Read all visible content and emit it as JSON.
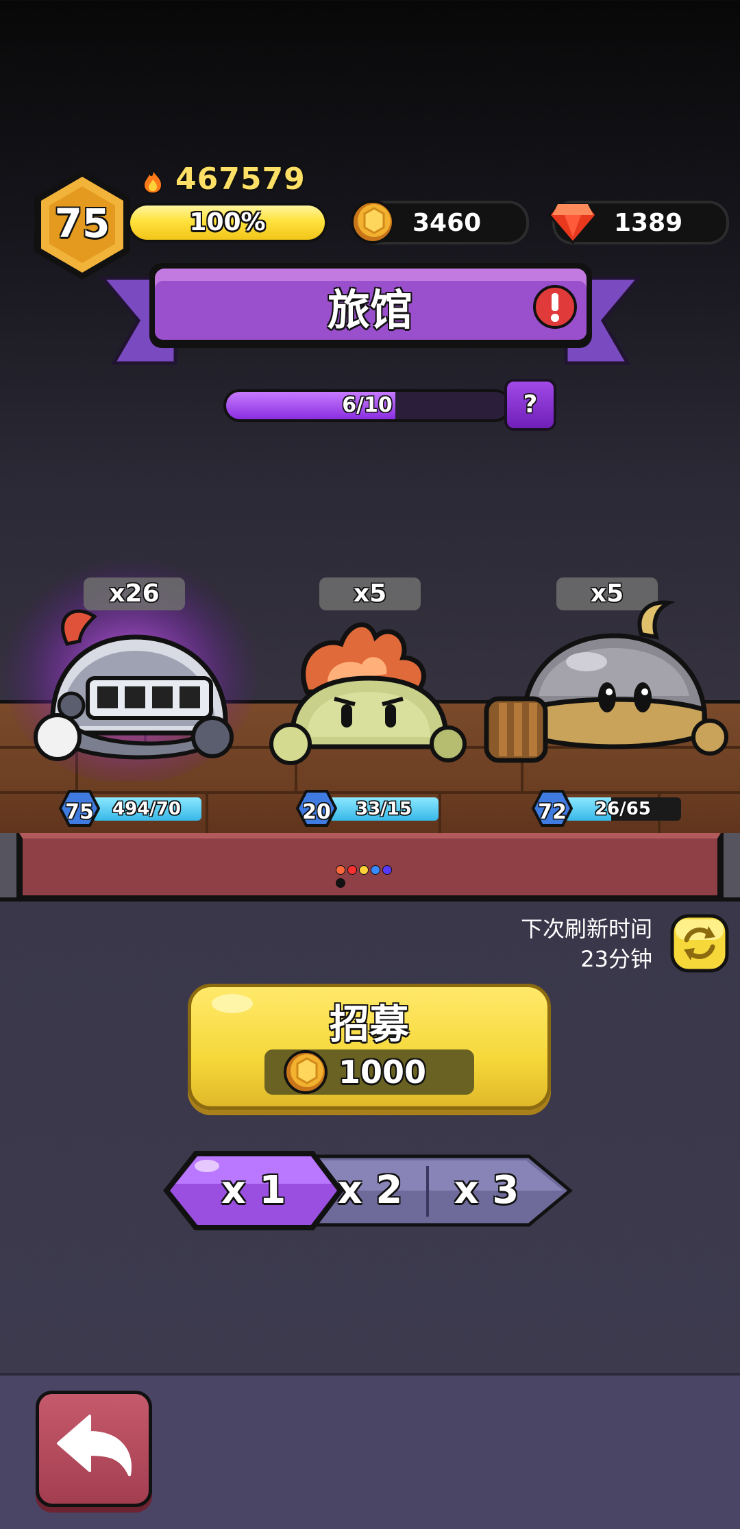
{
  "hud": {
    "level": "75",
    "power": "467579",
    "xp_percent": "100%",
    "xp_progress": 1.0,
    "gold": "3460",
    "gems": "1389"
  },
  "title": "旅馆",
  "floor_progress": {
    "text": "6/10",
    "value": 0.6
  },
  "help_label": "?",
  "heroes": [
    {
      "count": "x26",
      "level": "75",
      "stat": "494/70",
      "stat_fill": 1.0,
      "icon": "knight-helmet-slime-icon"
    },
    {
      "count": "x5",
      "level": "20",
      "stat": "33/15",
      "stat_fill": 1.0,
      "icon": "flame-slime-icon"
    },
    {
      "count": "x5",
      "level": "72",
      "stat": "26/65",
      "stat_fill": 0.4,
      "icon": "bomb-slime-icon"
    }
  ],
  "refresh": {
    "line1": "下次刷新时间",
    "line2": "23分钟"
  },
  "recruit": {
    "label": "招募",
    "cost": "1000"
  },
  "multipliers": [
    "x 1",
    "x 2",
    "x 3"
  ],
  "selected_multiplier": "x 1",
  "colors": {
    "accent_purple": "#8b2ee0",
    "gold_button": "#f6d83a",
    "shelf_red": "#8e4046",
    "back_button": "#b24a5c"
  },
  "dot_colors": [
    "#ff6a3a",
    "#ff3030",
    "#ffd23a",
    "#3a8bff",
    "#5a3aff",
    "#111111"
  ]
}
